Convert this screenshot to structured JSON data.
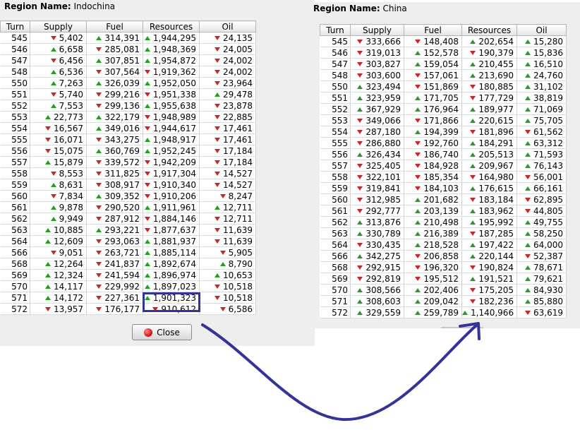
{
  "columns": [
    "Turn",
    "Supply",
    "Fuel",
    "Resources",
    "Oil"
  ],
  "left": {
    "region_label": "Region Name:",
    "region_value": "Indochina",
    "rows": [
      {
        "turn": "545",
        "supply": [
          "down",
          "5,402"
        ],
        "fuel": [
          "up",
          "314,391"
        ],
        "resources": [
          "up",
          "1,944,295"
        ],
        "oil": [
          "down",
          "24,135"
        ]
      },
      {
        "turn": "546",
        "supply": [
          "up",
          "6,658"
        ],
        "fuel": [
          "down",
          "285,081"
        ],
        "resources": [
          "up",
          "1,948,369"
        ],
        "oil": [
          "down",
          "24,005"
        ]
      },
      {
        "turn": "547",
        "supply": [
          "down",
          "6,456"
        ],
        "fuel": [
          "up",
          "307,851"
        ],
        "resources": [
          "up",
          "1,954,872"
        ],
        "oil": [
          "down",
          "24,002"
        ]
      },
      {
        "turn": "548",
        "supply": [
          "up",
          "6,536"
        ],
        "fuel": [
          "down",
          "307,564"
        ],
        "resources": [
          "down",
          "1,919,362"
        ],
        "oil": [
          "down",
          "24,002"
        ]
      },
      {
        "turn": "550",
        "supply": [
          "up",
          "7,263"
        ],
        "fuel": [
          "up",
          "326,039"
        ],
        "resources": [
          "up",
          "1,952,050"
        ],
        "oil": [
          "down",
          "23,964"
        ]
      },
      {
        "turn": "551",
        "supply": [
          "down",
          "5,740"
        ],
        "fuel": [
          "down",
          "299,216"
        ],
        "resources": [
          "down",
          "1,951,338"
        ],
        "oil": [
          "up",
          "29,478"
        ]
      },
      {
        "turn": "552",
        "supply": [
          "up",
          "7,553"
        ],
        "fuel": [
          "down",
          "299,136"
        ],
        "resources": [
          "up",
          "1,955,638"
        ],
        "oil": [
          "down",
          "23,878"
        ]
      },
      {
        "turn": "553",
        "supply": [
          "up",
          "22,773"
        ],
        "fuel": [
          "up",
          "322,179"
        ],
        "resources": [
          "down",
          "1,948,989"
        ],
        "oil": [
          "down",
          "22,885"
        ]
      },
      {
        "turn": "554",
        "supply": [
          "down",
          "16,567"
        ],
        "fuel": [
          "up",
          "349,016"
        ],
        "resources": [
          "down",
          "1,944,617"
        ],
        "oil": [
          "down",
          "17,461"
        ]
      },
      {
        "turn": "555",
        "supply": [
          "down",
          "16,071"
        ],
        "fuel": [
          "down",
          "343,275"
        ],
        "resources": [
          "up",
          "1,948,917"
        ],
        "oil": [
          "down",
          "17,461"
        ]
      },
      {
        "turn": "556",
        "supply": [
          "down",
          "15,075"
        ],
        "fuel": [
          "up",
          "360,769"
        ],
        "resources": [
          "up",
          "1,952,245"
        ],
        "oil": [
          "down",
          "17,184"
        ]
      },
      {
        "turn": "557",
        "supply": [
          "up",
          "15,879"
        ],
        "fuel": [
          "down",
          "339,572"
        ],
        "resources": [
          "down",
          "1,942,209"
        ],
        "oil": [
          "down",
          "17,184"
        ]
      },
      {
        "turn": "558",
        "supply": [
          "down",
          "8,553"
        ],
        "fuel": [
          "down",
          "311,825"
        ],
        "resources": [
          "down",
          "1,917,304"
        ],
        "oil": [
          "down",
          "14,527"
        ]
      },
      {
        "turn": "559",
        "supply": [
          "up",
          "8,631"
        ],
        "fuel": [
          "down",
          "308,917"
        ],
        "resources": [
          "down",
          "1,910,340"
        ],
        "oil": [
          "down",
          "14,527"
        ]
      },
      {
        "turn": "560",
        "supply": [
          "down",
          "7,834"
        ],
        "fuel": [
          "up",
          "309,352"
        ],
        "resources": [
          "down",
          "1,910,206"
        ],
        "oil": [
          "down",
          "8,247"
        ]
      },
      {
        "turn": "561",
        "supply": [
          "up",
          "9,878"
        ],
        "fuel": [
          "down",
          "290,520"
        ],
        "resources": [
          "up",
          "1,911,961"
        ],
        "oil": [
          "up",
          "12,711"
        ]
      },
      {
        "turn": "562",
        "supply": [
          "up",
          "9,949"
        ],
        "fuel": [
          "down",
          "287,912"
        ],
        "resources": [
          "down",
          "1,884,146"
        ],
        "oil": [
          "down",
          "12,711"
        ]
      },
      {
        "turn": "563",
        "supply": [
          "up",
          "10,885"
        ],
        "fuel": [
          "up",
          "293,221"
        ],
        "resources": [
          "down",
          "1,877,637"
        ],
        "oil": [
          "down",
          "11,639"
        ]
      },
      {
        "turn": "564",
        "supply": [
          "up",
          "12,609"
        ],
        "fuel": [
          "down",
          "293,063"
        ],
        "resources": [
          "up",
          "1,881,937"
        ],
        "oil": [
          "down",
          "11,639"
        ]
      },
      {
        "turn": "566",
        "supply": [
          "down",
          "9,051"
        ],
        "fuel": [
          "down",
          "263,721"
        ],
        "resources": [
          "up",
          "1,885,114"
        ],
        "oil": [
          "down",
          "5,905"
        ]
      },
      {
        "turn": "568",
        "supply": [
          "up",
          "12,264"
        ],
        "fuel": [
          "down",
          "241,837"
        ],
        "resources": [
          "up",
          "1,892,674"
        ],
        "oil": [
          "up",
          "8,790"
        ]
      },
      {
        "turn": "569",
        "supply": [
          "up",
          "12,324"
        ],
        "fuel": [
          "down",
          "241,594"
        ],
        "resources": [
          "up",
          "1,896,974"
        ],
        "oil": [
          "up",
          "10,653"
        ]
      },
      {
        "turn": "570",
        "supply": [
          "up",
          "14,117"
        ],
        "fuel": [
          "down",
          "229,992"
        ],
        "resources": [
          "up",
          "1,897,023"
        ],
        "oil": [
          "down",
          "10,518"
        ]
      },
      {
        "turn": "571",
        "supply": [
          "up",
          "14,172"
        ],
        "fuel": [
          "down",
          "227,361"
        ],
        "resources": [
          "up",
          "1,901,323"
        ],
        "oil": [
          "down",
          "10,518"
        ]
      },
      {
        "turn": "572",
        "supply": [
          "down",
          "13,957"
        ],
        "fuel": [
          "down",
          "176,177"
        ],
        "resources": [
          "down",
          "910,612"
        ],
        "oil": [
          "down",
          "6,586"
        ]
      }
    ],
    "close_label": "Close"
  },
  "right": {
    "region_label": "Region Name:",
    "region_value": "China",
    "rows": [
      {
        "turn": "545",
        "supply": [
          "down",
          "333,666"
        ],
        "fuel": [
          "down",
          "148,408"
        ],
        "resources": [
          "up",
          "202,654"
        ],
        "oil": [
          "up",
          "15,280"
        ]
      },
      {
        "turn": "546",
        "supply": [
          "down",
          "319,013"
        ],
        "fuel": [
          "up",
          "152,578"
        ],
        "resources": [
          "down",
          "190,379"
        ],
        "oil": [
          "up",
          "15,836"
        ]
      },
      {
        "turn": "547",
        "supply": [
          "down",
          "303,827"
        ],
        "fuel": [
          "up",
          "159,054"
        ],
        "resources": [
          "up",
          "210,455"
        ],
        "oil": [
          "up",
          "16,510"
        ]
      },
      {
        "turn": "548",
        "supply": [
          "down",
          "303,600"
        ],
        "fuel": [
          "down",
          "157,061"
        ],
        "resources": [
          "up",
          "213,690"
        ],
        "oil": [
          "up",
          "24,760"
        ]
      },
      {
        "turn": "550",
        "supply": [
          "up",
          "323,494"
        ],
        "fuel": [
          "down",
          "151,869"
        ],
        "resources": [
          "down",
          "180,885"
        ],
        "oil": [
          "up",
          "31,102"
        ]
      },
      {
        "turn": "551",
        "supply": [
          "up",
          "323,959"
        ],
        "fuel": [
          "up",
          "171,705"
        ],
        "resources": [
          "down",
          "177,729"
        ],
        "oil": [
          "up",
          "38,819"
        ]
      },
      {
        "turn": "552",
        "supply": [
          "up",
          "367,929"
        ],
        "fuel": [
          "up",
          "176,964"
        ],
        "resources": [
          "up",
          "189,977"
        ],
        "oil": [
          "up",
          "71,069"
        ]
      },
      {
        "turn": "553",
        "supply": [
          "down",
          "349,066"
        ],
        "fuel": [
          "down",
          "171,866"
        ],
        "resources": [
          "up",
          "220,615"
        ],
        "oil": [
          "up",
          "75,705"
        ]
      },
      {
        "turn": "554",
        "supply": [
          "down",
          "287,180"
        ],
        "fuel": [
          "up",
          "194,399"
        ],
        "resources": [
          "down",
          "181,896"
        ],
        "oil": [
          "down",
          "61,562"
        ]
      },
      {
        "turn": "555",
        "supply": [
          "down",
          "286,880"
        ],
        "fuel": [
          "down",
          "192,760"
        ],
        "resources": [
          "up",
          "184,291"
        ],
        "oil": [
          "up",
          "63,312"
        ]
      },
      {
        "turn": "556",
        "supply": [
          "up",
          "326,434"
        ],
        "fuel": [
          "down",
          "186,740"
        ],
        "resources": [
          "up",
          "205,513"
        ],
        "oil": [
          "up",
          "71,593"
        ]
      },
      {
        "turn": "557",
        "supply": [
          "down",
          "325,405"
        ],
        "fuel": [
          "down",
          "184,928"
        ],
        "resources": [
          "up",
          "209,967"
        ],
        "oil": [
          "up",
          "76,143"
        ]
      },
      {
        "turn": "558",
        "supply": [
          "down",
          "322,101"
        ],
        "fuel": [
          "down",
          "185,354"
        ],
        "resources": [
          "down",
          "164,980"
        ],
        "oil": [
          "down",
          "56,001"
        ]
      },
      {
        "turn": "559",
        "supply": [
          "down",
          "319,841"
        ],
        "fuel": [
          "down",
          "184,103"
        ],
        "resources": [
          "up",
          "176,615"
        ],
        "oil": [
          "up",
          "66,161"
        ]
      },
      {
        "turn": "560",
        "supply": [
          "down",
          "312,985"
        ],
        "fuel": [
          "up",
          "201,682"
        ],
        "resources": [
          "down",
          "183,184"
        ],
        "oil": [
          "down",
          "62,895"
        ]
      },
      {
        "turn": "561",
        "supply": [
          "down",
          "292,777"
        ],
        "fuel": [
          "up",
          "203,139"
        ],
        "resources": [
          "up",
          "183,962"
        ],
        "oil": [
          "down",
          "44,805"
        ]
      },
      {
        "turn": "562",
        "supply": [
          "up",
          "313,876"
        ],
        "fuel": [
          "up",
          "210,498"
        ],
        "resources": [
          "up",
          "195,992"
        ],
        "oil": [
          "up",
          "49,755"
        ]
      },
      {
        "turn": "563",
        "supply": [
          "up",
          "330,789"
        ],
        "fuel": [
          "up",
          "216,389"
        ],
        "resources": [
          "down",
          "187,285"
        ],
        "oil": [
          "up",
          "58,250"
        ]
      },
      {
        "turn": "564",
        "supply": [
          "down",
          "330,435"
        ],
        "fuel": [
          "up",
          "218,528"
        ],
        "resources": [
          "up",
          "197,422"
        ],
        "oil": [
          "up",
          "64,000"
        ]
      },
      {
        "turn": "566",
        "supply": [
          "up",
          "342,275"
        ],
        "fuel": [
          "down",
          "206,858"
        ],
        "resources": [
          "up",
          "220,144"
        ],
        "oil": [
          "down",
          "52,387"
        ]
      },
      {
        "turn": "568",
        "supply": [
          "down",
          "292,915"
        ],
        "fuel": [
          "down",
          "196,320"
        ],
        "resources": [
          "down",
          "190,824"
        ],
        "oil": [
          "up",
          "78,671"
        ]
      },
      {
        "turn": "569",
        "supply": [
          "down",
          "292,819"
        ],
        "fuel": [
          "down",
          "195,512"
        ],
        "resources": [
          "up",
          "191,521"
        ],
        "oil": [
          "up",
          "79,621"
        ]
      },
      {
        "turn": "570",
        "supply": [
          "up",
          "308,566"
        ],
        "fuel": [
          "up",
          "202,406"
        ],
        "resources": [
          "down",
          "175,205"
        ],
        "oil": [
          "up",
          "84,930"
        ]
      },
      {
        "turn": "571",
        "supply": [
          "up",
          "308,603"
        ],
        "fuel": [
          "up",
          "209,042"
        ],
        "resources": [
          "down",
          "182,236"
        ],
        "oil": [
          "up",
          "85,880"
        ]
      },
      {
        "turn": "572",
        "supply": [
          "up",
          "329,559"
        ],
        "fuel": [
          "up",
          "259,789"
        ],
        "resources": [
          "up",
          "1,140,966"
        ],
        "oil": [
          "down",
          "63,619"
        ]
      }
    ]
  },
  "colors": {
    "up": "#1fa31f",
    "down": "#d42020",
    "annotation": "#333399"
  }
}
